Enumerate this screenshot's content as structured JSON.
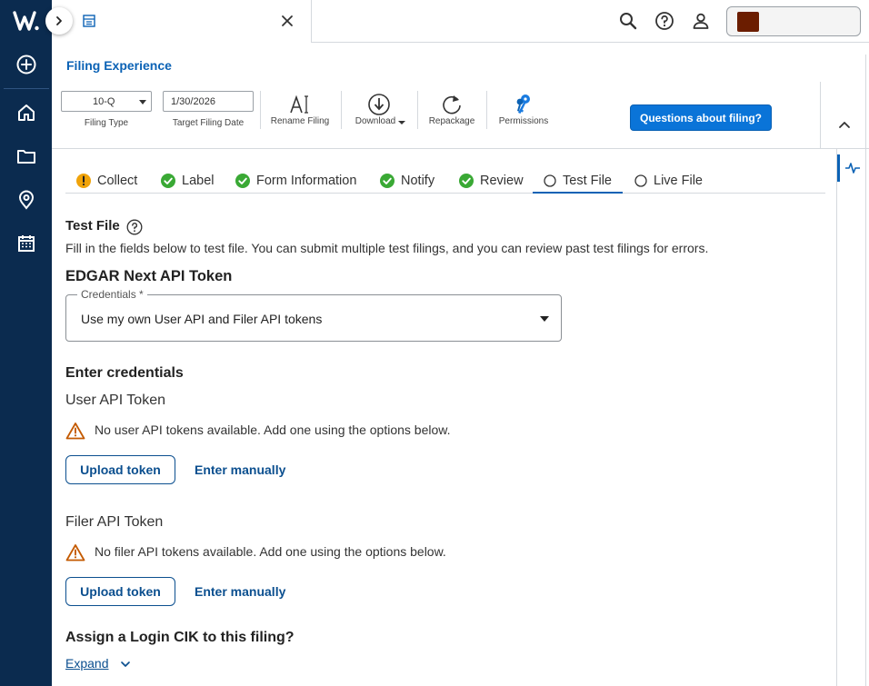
{
  "app": {
    "logo": "W",
    "brand_color": "#0b2b4f",
    "accent": "#0b62b5"
  },
  "rail": {
    "items": [
      {
        "icon": "plus-circle-icon"
      },
      {
        "icon": "home-icon"
      },
      {
        "icon": "folder-icon"
      },
      {
        "icon": "location-pin-icon"
      },
      {
        "icon": "calendar-icon"
      }
    ]
  },
  "topbar": {
    "doc_icon": "document-icon",
    "close_icon": "close-icon",
    "icons": [
      "search-icon",
      "help-icon",
      "user-icon"
    ]
  },
  "header": {
    "title": "Filing Experience",
    "filing_type": {
      "value": "10-Q",
      "caption": "Filing Type"
    },
    "target_date": {
      "value": "1/30/2026",
      "caption": "Target Filing Date"
    },
    "tools": {
      "rename": "Rename Filing",
      "download": "Download",
      "repackage": "Repackage",
      "permissions": "Permissions"
    },
    "questions_button": "Questions about filing?"
  },
  "tabs": [
    {
      "label": "Collect",
      "status": "warning"
    },
    {
      "label": "Label",
      "status": "done"
    },
    {
      "label": "Form Information",
      "status": "done"
    },
    {
      "label": "Notify",
      "status": "done"
    },
    {
      "label": "Review",
      "status": "done"
    },
    {
      "label": "Test File",
      "status": "open",
      "active": true
    },
    {
      "label": "Live File",
      "status": "open"
    }
  ],
  "content": {
    "section_title": "Test File",
    "description": "Fill in the fields below to test file. You can submit multiple test filings, and you can review past test filings for errors.",
    "api_heading": "EDGAR Next API Token",
    "credentials": {
      "label": "Credentials *",
      "value": "Use my own User API and Filer API tokens"
    },
    "enter_heading": "Enter credentials",
    "user_token": {
      "title": "User API Token",
      "warning": "No user API tokens available. Add one using the options below.",
      "upload": "Upload token",
      "manual": "Enter manually"
    },
    "filer_token": {
      "title": "Filer API Token",
      "warning": "No filer API tokens available. Add one using the options below.",
      "upload": "Upload token",
      "manual": "Enter manually"
    },
    "cik_heading": "Assign a Login CIK to this filing?",
    "expand": "Expand"
  }
}
